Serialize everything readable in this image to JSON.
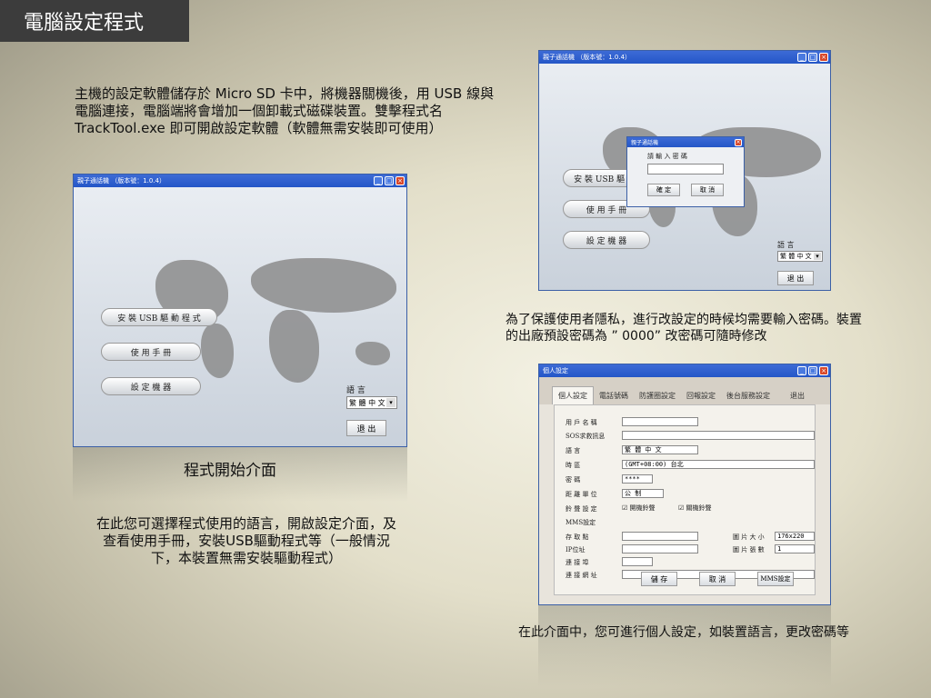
{
  "page_title": "電腦設定程式",
  "intro_text": "主機的設定軟體儲存於 Micro SD 卡中，將機器關機後，用 USB 線與電腦連接，電腦端將會增加一個卸載式磁碟裝置。雙擊程式名 TrackTool.exe 即可開啟設定軟體（軟體無需安裝即可使用）",
  "caption_start": "程式開始介面",
  "start_desc": "在此您可選擇程式使用的語言，開啟設定介面，及查看使用手冊，安裝USB驅動程式等（一般情況下，本裝置無需安裝驅動程式）",
  "password_desc": "為了保護使用者隱私，進行改設定的時候均需要輸入密碼。裝置的出廠預設密碼為 ” 0000” 改密碼可隨時修改",
  "personal_desc": "在此介面中，您可進行個人設定，如裝置語言，更改密碼等",
  "main_window": {
    "title": "親子通話機 （版本號：1.0.4）",
    "btn_install": "安 裝  USB  驅 動 程 式",
    "btn_manual": "使 用 手 冊",
    "btn_settings": "設 定 機 器",
    "lang_label": "語 言",
    "lang_value": "繁 體 中 文",
    "exit": "退 出"
  },
  "pw_window": {
    "title": "親子通話機 （版本號：1.0.4）",
    "btn_install": "安 裝  USB  驅 動 程",
    "btn_manual": "使 用 手 冊",
    "btn_settings": "設 定 機 器",
    "lang_label": "語 言",
    "lang_value": "繁 體 中 文",
    "exit": "退 出",
    "dialog_title": "親子通話機",
    "dialog_prompt": "請 輸 入 密 碼",
    "ok": "確 定",
    "cancel": "取 消"
  },
  "settings_window": {
    "title": "個人設定",
    "tabs": [
      "個人設定",
      "電話號碼",
      "防護圈設定",
      "回報設定",
      "後台服務設定",
      "退出"
    ],
    "fields": {
      "username": "用 戶 名 稱",
      "sos_msg": "SOS求救訊息",
      "language": "語 言",
      "language_value": "繁 體 中 文",
      "timezone": "時 區",
      "timezone_value": "(GMT+08:00) 台北",
      "password": "密 碼",
      "password_value": "****",
      "distance_unit": "距 離 單 位",
      "distance_value": "公 制",
      "ring_setting": "鈴 聲 設 定",
      "ring_option1": "開機鈴聲",
      "ring_option2": "關機鈴聲",
      "mms_setting": "MMS設定",
      "access_point": "存 取 點",
      "ip_address": "IP位址",
      "port": "連 接 埠",
      "url": "連 接 網 址",
      "image_size": "圖 片 大 小",
      "image_size_value": "176x220",
      "image_count": "圖 片 張 數",
      "image_count_value": "1"
    },
    "save": "儲 存",
    "cancel": "取 消",
    "mms_btn": "MMS設定"
  }
}
